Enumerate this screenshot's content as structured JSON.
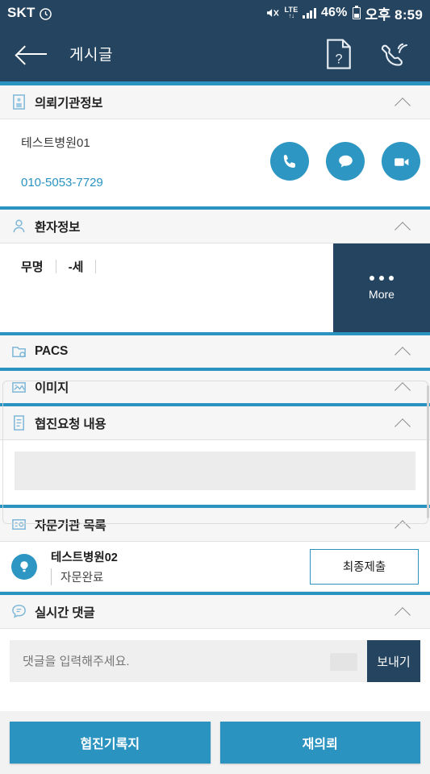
{
  "status_bar": {
    "carrier": "SKT",
    "network": "LTE",
    "battery_percent": "46%",
    "time": "오후 8:59",
    "icons": [
      "alarm-icon",
      "mute-icon",
      "lte-icon",
      "signal-bars-icon",
      "battery-icon"
    ]
  },
  "app_bar": {
    "title": "게시글",
    "back_icon": "back-arrow-icon",
    "actions": [
      {
        "name": "help-document-icon",
        "glyph": "?"
      },
      {
        "name": "phone-ring-icon"
      }
    ]
  },
  "sections": {
    "institution": {
      "label": "의뢰기관정보",
      "icon": "hospital-building-icon",
      "collapse_icon": "chevron-up-icon",
      "hospital_name": "테스트병원01",
      "phone": "010-5053-7729",
      "actions": [
        {
          "name": "call-button",
          "icon": "phone-icon"
        },
        {
          "name": "chat-button",
          "icon": "chat-bubble-icon"
        },
        {
          "name": "video-call-button",
          "icon": "video-camera-icon"
        }
      ]
    },
    "patient": {
      "label": "환자정보",
      "icon": "person-icon",
      "name": "무명",
      "age": "-세",
      "extra": "",
      "more_label": "More",
      "more_icon": "three-dots-icon"
    },
    "pacs": {
      "label": "PACS",
      "icon": "pacs-folder-icon",
      "collapse_icon": "chevron-up-icon"
    },
    "image": {
      "label": "이미지",
      "icon": "image-icon",
      "collapse_icon": "chevron-up-icon"
    },
    "request": {
      "label": "협진요청 내용",
      "icon": "document-lines-icon",
      "collapse_icon": "chevron-up-icon",
      "content": ""
    },
    "consultants": {
      "label": "자문기관 목록",
      "icon": "list-icon",
      "collapse_icon": "chevron-up-icon",
      "rows": [
        {
          "icon": "bulb-icon",
          "name": "테스트병원02",
          "status": "자문완료",
          "action_label": "최종제출"
        }
      ]
    },
    "comments": {
      "label": "실시간 댓글",
      "icon": "comment-bubble-icon",
      "collapse_icon": "chevron-up-icon",
      "input_value": "",
      "input_placeholder": "댓글을 입력해주세요.",
      "send_label": "보내기"
    }
  },
  "bottom_actions": {
    "record_label": "협진기록지",
    "rerequest_label": "재의뢰"
  },
  "colors": {
    "navy": "#25445f",
    "teal": "#2a93c0",
    "circle_teal": "#2d96c2",
    "section_bg": "#f6f6f6",
    "field_bg": "#efefef"
  }
}
